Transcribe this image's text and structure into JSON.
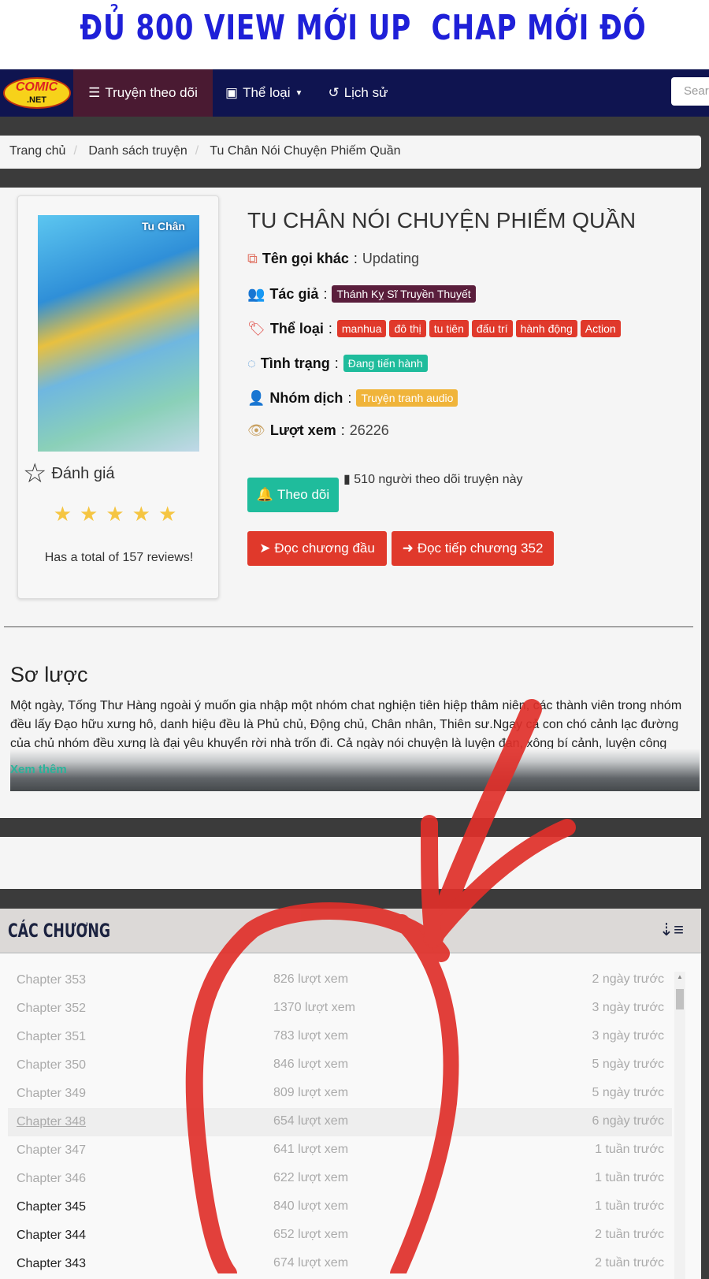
{
  "banner": "ĐỦ 800 VIEW MỚI UP  CHAP MỚI ĐÓ",
  "nav": {
    "logo_text": "COMIC",
    "logo_sub": ".NET",
    "items": [
      {
        "label": "Truyện theo dõi",
        "icon": "list-icon"
      },
      {
        "label": "Thể loại",
        "icon": "book-icon"
      },
      {
        "label": "Lịch sử",
        "icon": "history-icon"
      }
    ],
    "search_placeholder": "Search"
  },
  "breadcrumb": [
    "Trang chủ",
    "Danh sách truyện",
    "Tu Chân Nói Chuyện Phiếm Quần"
  ],
  "comic": {
    "cover_text": "Tu Chân",
    "title": "TU CHÂN NÓI CHUYỆN PHIẾM QUẦN",
    "other_name_label": "Tên gọi khác",
    "other_name": "Updating",
    "author_label": "Tác giả",
    "author": "Thánh Kỵ Sĩ Truyền Thuyết",
    "genre_label": "Thể loại",
    "genres": [
      "manhua",
      "đô thị",
      "tu tiên",
      "đấu trí",
      "hành động",
      "Action"
    ],
    "status_label": "Tình trạng",
    "status": "Đang tiến hành",
    "group_label": "Nhóm dịch",
    "group": "Truyện tranh audio",
    "views_label": "Lượt xem",
    "views": "26226",
    "follow_button": "Theo dõi",
    "followers_text": "510 người theo dõi truyện này",
    "read_first": "Đọc chương đầu",
    "read_next": "Đọc tiếp chương 352",
    "rating_label": "Đánh giá",
    "rating": 5,
    "rating_max": 5,
    "reviews_text": "Has a total of 157 reviews!"
  },
  "summary": {
    "heading": "Sơ lược",
    "text": "Một ngày, Tống Thư Hàng ngoài ý muốn gia nhập một nhóm chat nghiện tiên hiệp thâm niên, các thành viên trong nhóm đều lấy Đạo hữu xưng hô, danh hiệu đều là Phủ chủ, Động chủ, Chân nhân, Thiên sư.Ngay cả con chó cảnh lạc đường của chủ nhóm đều xưng là đại yêu khuyển rời nhà trốn đi. Cả ngày nói chuyện là luyện đan, xông bí cảnh, luyện công kinh nghiệm cái gì. Đột nhiên có một ngày, lặn xuống nước hồi lâu... đột nhiên phát",
    "more": "Xem thêm"
  },
  "chapters": {
    "heading": "CÁC CHƯƠNG",
    "rows": [
      {
        "name": "Chapter 353",
        "views": "826 lượt xem",
        "time": "2 ngày trước",
        "read": false
      },
      {
        "name": "Chapter 352",
        "views": "1370 lượt xem",
        "time": "3 ngày trước",
        "read": false
      },
      {
        "name": "Chapter 351",
        "views": "783 lượt xem",
        "time": "3 ngày trước",
        "read": false
      },
      {
        "name": "Chapter 350",
        "views": "846 lượt xem",
        "time": "5 ngày trước",
        "read": false
      },
      {
        "name": "Chapter 349",
        "views": "809 lượt xem",
        "time": "5 ngày trước",
        "read": false
      },
      {
        "name": "Chapter 348",
        "views": "654 lượt xem",
        "time": "6 ngày trước",
        "read": false,
        "hover": true
      },
      {
        "name": "Chapter 347",
        "views": "641 lượt xem",
        "time": "1 tuần trước",
        "read": false
      },
      {
        "name": "Chapter 346",
        "views": "622 lượt xem",
        "time": "1 tuần trước",
        "read": false
      },
      {
        "name": "Chapter 345",
        "views": "840 lượt xem",
        "time": "1 tuần trước",
        "read": true
      },
      {
        "name": "Chapter 344",
        "views": "652 lượt xem",
        "time": "2 tuần trước",
        "read": true
      },
      {
        "name": "Chapter 343",
        "views": "674 lượt xem",
        "time": "2 tuần trước",
        "read": true
      }
    ]
  },
  "colors": {
    "nav": "#0f1450",
    "nav_active": "#4a1a32",
    "author": "#5a1e3c",
    "genre": "#e0392b",
    "status": "#1fbc9c",
    "group": "#f0b43a",
    "annotation": "#e0302a",
    "banner": "#1f20d8"
  }
}
